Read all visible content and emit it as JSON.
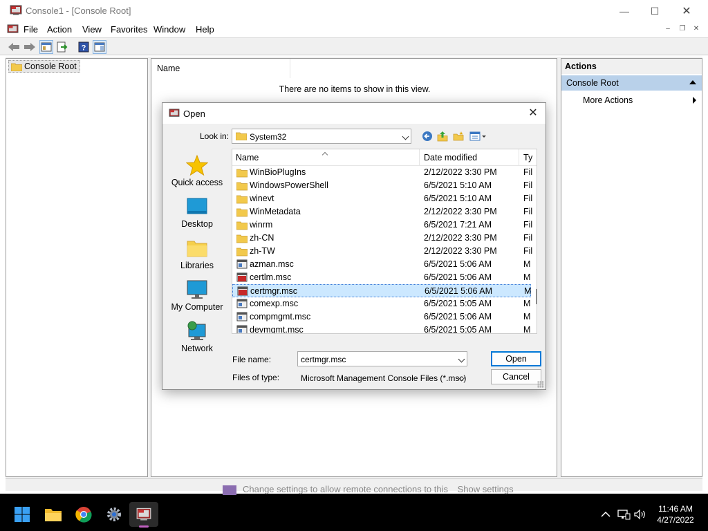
{
  "window": {
    "title": "Console1 - [Console Root]",
    "minimize": "—",
    "maximize": "☐",
    "close": "✕"
  },
  "menu": {
    "file": "File",
    "action": "Action",
    "view": "View",
    "favorites": "Favorites",
    "window": "Window",
    "help": "Help"
  },
  "mdi": {
    "minimize": "–",
    "restore": "❐",
    "close": "✕"
  },
  "tree": {
    "root": "Console Root"
  },
  "list": {
    "column_name": "Name",
    "empty_text": "There are no items to show in this view."
  },
  "actions": {
    "header": "Actions",
    "group": "Console Root",
    "more": "More Actions"
  },
  "dialog": {
    "title": "Open",
    "look_in_label": "Look in:",
    "look_in_value": "System32",
    "places": [
      "Quick access",
      "Desktop",
      "Libraries",
      "My Computer",
      "Network"
    ],
    "columns": {
      "name": "Name",
      "date": "Date modified",
      "type": "Ty"
    },
    "files": [
      {
        "name": "WinBioPlugIns",
        "date": "2/12/2022 3:30 PM",
        "type": "Fil",
        "kind": "folder"
      },
      {
        "name": "WindowsPowerShell",
        "date": "6/5/2021 5:10 AM",
        "type": "Fil",
        "kind": "folder"
      },
      {
        "name": "winevt",
        "date": "6/5/2021 5:10 AM",
        "type": "Fil",
        "kind": "folder"
      },
      {
        "name": "WinMetadata",
        "date": "2/12/2022 3:30 PM",
        "type": "Fil",
        "kind": "folder"
      },
      {
        "name": "winrm",
        "date": "6/5/2021 7:21 AM",
        "type": "Fil",
        "kind": "folder"
      },
      {
        "name": "zh-CN",
        "date": "2/12/2022 3:30 PM",
        "type": "Fil",
        "kind": "folder"
      },
      {
        "name": "zh-TW",
        "date": "2/12/2022 3:30 PM",
        "type": "Fil",
        "kind": "folder"
      },
      {
        "name": "azman.msc",
        "date": "6/5/2021 5:06 AM",
        "type": "M",
        "kind": "msc"
      },
      {
        "name": "certlm.msc",
        "date": "6/5/2021 5:06 AM",
        "type": "M",
        "kind": "msc-red"
      },
      {
        "name": "certmgr.msc",
        "date": "6/5/2021 5:06 AM",
        "type": "M",
        "kind": "msc-red",
        "selected": true
      },
      {
        "name": "comexp.msc",
        "date": "6/5/2021 5:05 AM",
        "type": "M",
        "kind": "msc"
      },
      {
        "name": "compmgmt.msc",
        "date": "6/5/2021 5:06 AM",
        "type": "M",
        "kind": "msc"
      },
      {
        "name": "devmgmt.msc",
        "date": "6/5/2021 5:05 AM",
        "type": "M",
        "kind": "msc"
      }
    ],
    "file_name_label": "File name:",
    "file_name_value": "certmgr.msc",
    "files_of_type_label": "Files of type:",
    "files_of_type_value": "Microsoft Management Console Files (*.msc)",
    "open_button": "Open",
    "cancel_button": "Cancel"
  },
  "notification": {
    "text": "Change settings to allow remote connections to this",
    "link": "Show settings"
  },
  "taskbar": {
    "time": "11:46 AM",
    "date": "4/27/2022"
  }
}
